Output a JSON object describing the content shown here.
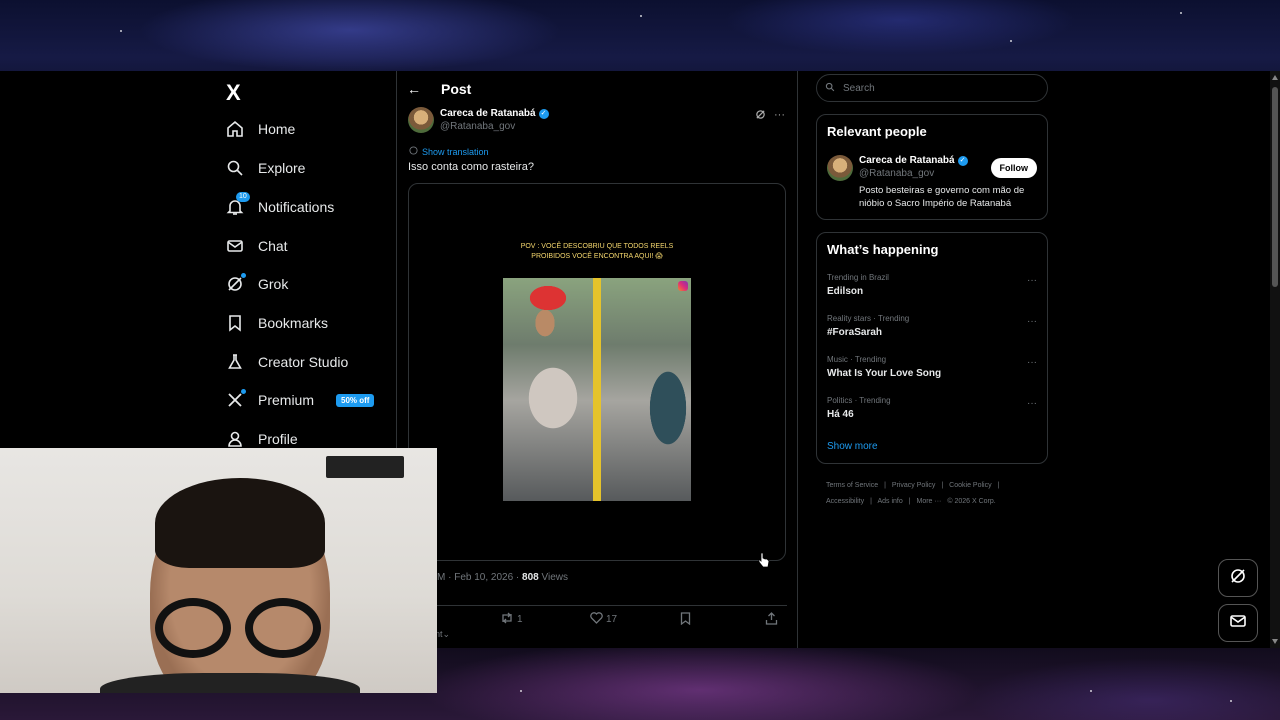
{
  "nav": {
    "logo": "X",
    "items": [
      {
        "label": "Home",
        "icon": "home-icon"
      },
      {
        "label": "Explore",
        "icon": "search-icon"
      },
      {
        "label": "Notifications",
        "icon": "bell-icon",
        "badge": "10"
      },
      {
        "label": "Chat",
        "icon": "mail-icon"
      },
      {
        "label": "Grok",
        "icon": "grok-icon"
      },
      {
        "label": "Bookmarks",
        "icon": "bookmark-icon"
      },
      {
        "label": "Creator Studio",
        "icon": "flask-icon"
      },
      {
        "label": "Premium",
        "icon": "x-logo-icon",
        "promo": "50% off"
      },
      {
        "label": "Profile",
        "icon": "person-icon"
      }
    ]
  },
  "post": {
    "header_title": "Post",
    "author_name": "Careca de Ratanabá",
    "author_handle": "@Ratanaba_gov",
    "show_translation": "Show translation",
    "text": "Isso conta como rasteira?",
    "media_caption_line1": "POV : VOCÊ DESCOBRIU QUE TODOS REELS",
    "media_caption_line2": "PROIBIDOS VOCÊ ENCONTRA AQUI! 😱",
    "time_date": "M · Feb 10, 2026 · ",
    "views_count": "808",
    "views_label": " Views",
    "reposts": "1",
    "likes": "17",
    "sort_label": "ent"
  },
  "search": {
    "placeholder": "Search"
  },
  "relevant": {
    "title": "Relevant people",
    "name": "Careca de Ratanabá",
    "handle": "@Ratanaba_gov",
    "follow_label": "Follow",
    "bio": "Posto besteiras e governo com mão de nióbio o Sacro Império de Ratanabá"
  },
  "happening": {
    "title": "What’s happening",
    "trends": [
      {
        "category": "Trending in Brazil",
        "title": "Edilson"
      },
      {
        "category": "Reality stars · Trending",
        "title": "#ForaSarah"
      },
      {
        "category": "Music · Trending",
        "title": "What Is Your Love Song"
      },
      {
        "category": "Politics · Trending",
        "title": "Há 46"
      }
    ],
    "show_more": "Show more"
  },
  "footer": {
    "line1": [
      "Terms of Service",
      "|",
      "Privacy Policy",
      "|",
      "Cookie Policy",
      "|"
    ],
    "line2": [
      "Accessibility",
      "|",
      "Ads info",
      "|",
      "More ···",
      "© 2026 X Corp."
    ]
  },
  "colors": {
    "accent": "#1d9bf0",
    "background": "#000000",
    "border": "#2f3336",
    "muted": "#71767b"
  }
}
